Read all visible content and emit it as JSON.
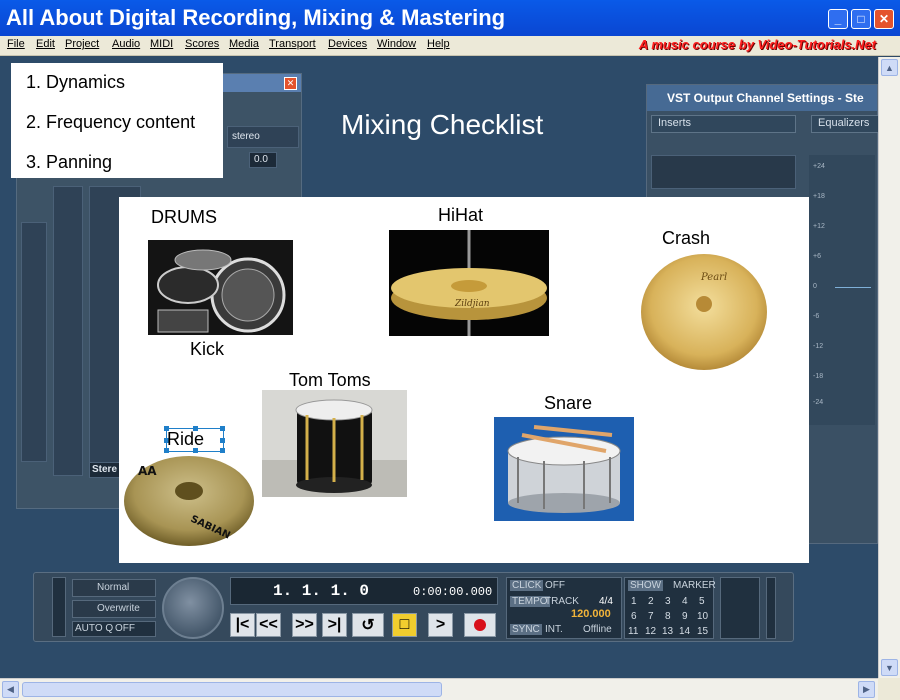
{
  "window": {
    "title": "All About Digital Recording, Mixing & Mastering",
    "tagline": "A music course by Video-Tutorials.Net",
    "buttons": {
      "minimize": "_",
      "maximize": "□",
      "close": "✕"
    }
  },
  "menu": {
    "items": [
      "File",
      "Edit",
      "Project",
      "Audio",
      "MIDI",
      "Scores",
      "Media",
      "Transport",
      "Devices",
      "Window",
      "Help"
    ]
  },
  "mixer": {
    "stereo_label": "stereo",
    "pan_value": "0.0",
    "footer_label": "Stere"
  },
  "vst_panel": {
    "title": "VST Output Channel Settings - Ste",
    "tab_inserts": "Inserts",
    "tab_equalizers": "Equalizers",
    "scale": [
      "+24",
      "+18",
      "+12",
      "+6",
      "0",
      "-6",
      "-12",
      "-18",
      "-24"
    ]
  },
  "slide": {
    "heading": "Mixing Checklist",
    "checklist": [
      "1. Dynamics",
      "2. Frequency content",
      "3. Panning"
    ],
    "labels": {
      "drums": "DRUMS",
      "kick": "Kick",
      "hihat": "HiHat",
      "crash": "Crash",
      "tomtoms": "Tom Toms",
      "ride": "Ride",
      "snare": "Snare"
    },
    "image_names": {
      "drums": "drum-kit-photo",
      "hihat": "hihat-cymbal-photo",
      "crash": "crash-cymbal-photo",
      "tomtoms": "tom-drum-photo",
      "ride": "ride-cymbal-photo",
      "snare": "snare-drum-photo"
    },
    "cymbal_brands": {
      "hihat": "Zildjian",
      "crash": "Pearl",
      "ride": "SABIAN",
      "ride_series": "AA"
    }
  },
  "transport": {
    "mode_normal": "Normal",
    "mode_overwrite": "Overwrite",
    "autoq": "AUTO Q",
    "autoq_state": "OFF",
    "position": "1. 1. 1.   0",
    "time": "0:00:00.000",
    "click_label": "CLICK",
    "click_state": "OFF",
    "tempo_label": "TEMPO",
    "track_label": "TRACK",
    "signature": "4/4",
    "tempo_value": "120.000",
    "sync_label": "SYNC",
    "sync_int": "INT.",
    "sync_state": "Offline",
    "show_label": "SHOW",
    "marker_label": "MARKER",
    "marker_numbers": [
      "1",
      "2",
      "3",
      "4",
      "5",
      "6",
      "7",
      "8",
      "9",
      "10",
      "11",
      "12",
      "13",
      "14",
      "15"
    ],
    "buttons": [
      "|<",
      "<<",
      ">>",
      ">|",
      "cycle",
      "stop",
      ">",
      "record"
    ]
  },
  "colors": {
    "title_bar": "#0a5ae8",
    "tagline": "#ff2020",
    "selection": "#1f7fc9",
    "stop_active": "#f1cd2e",
    "record": "#d8101a",
    "tempo_value": "#f2b43a"
  }
}
